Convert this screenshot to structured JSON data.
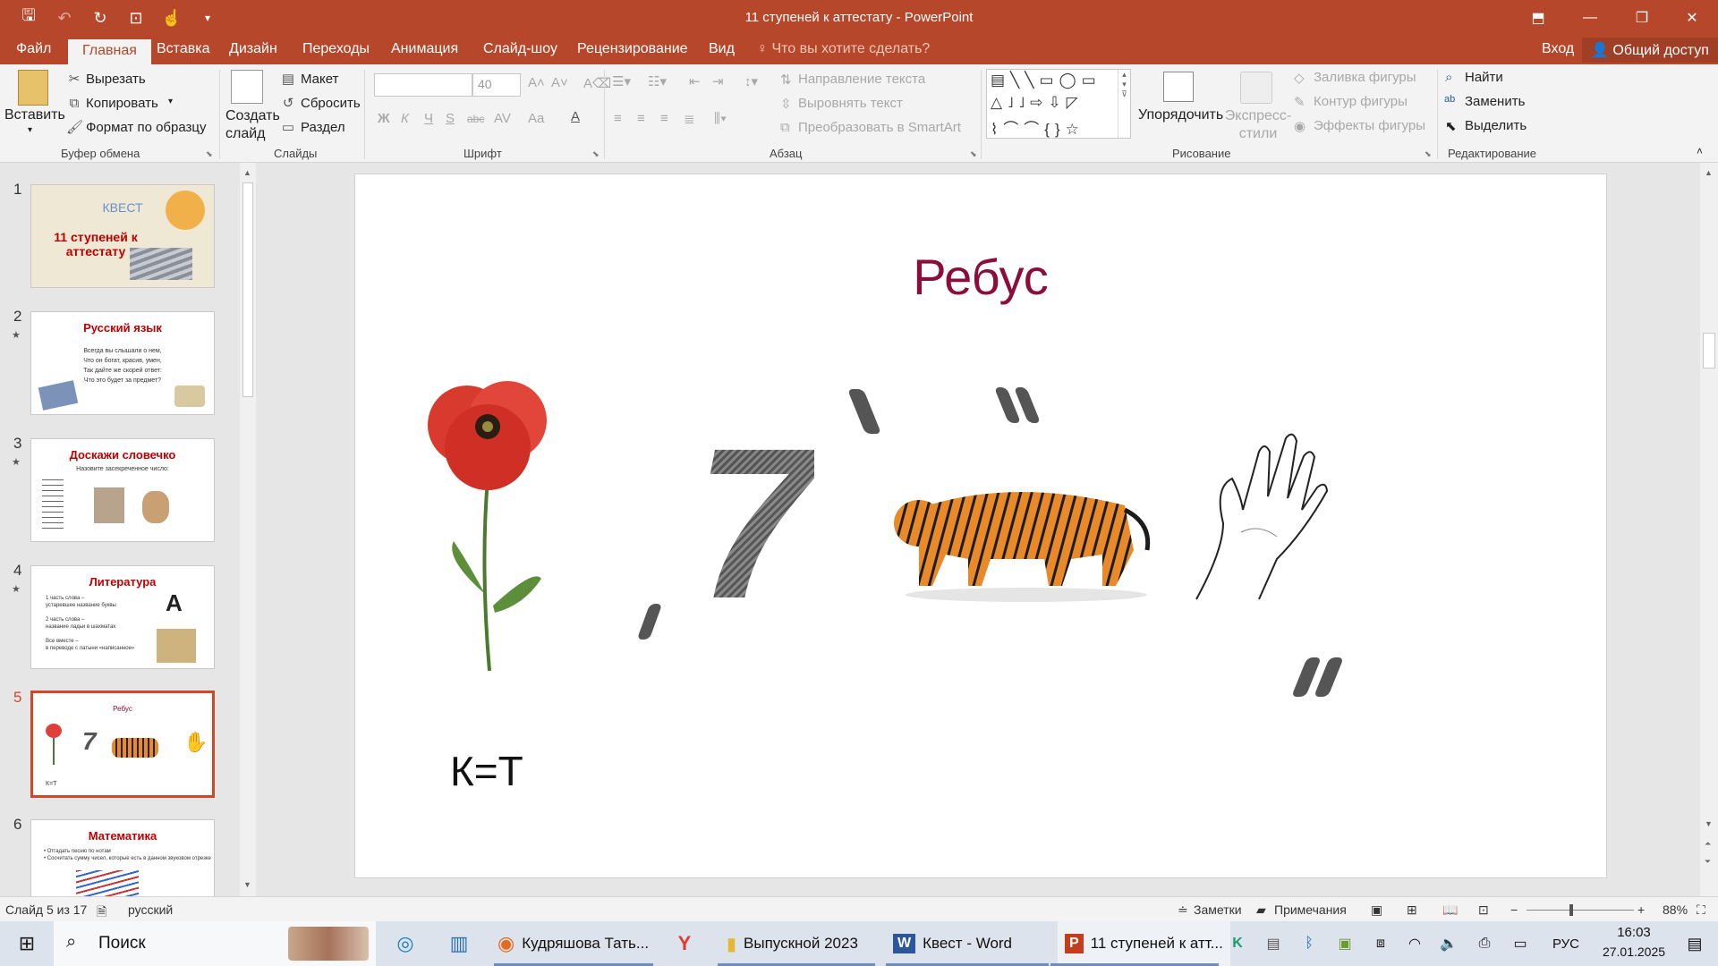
{
  "window": {
    "title": "11 ступеней к аттестату - PowerPoint",
    "qat": [
      "save-icon",
      "undo-icon",
      "redo-icon",
      "present-icon",
      "touch-icon",
      "customize-icon"
    ]
  },
  "tabs": {
    "items": [
      "Файл",
      "Главная",
      "Вставка",
      "Дизайн",
      "Переходы",
      "Анимация",
      "Слайд-шоу",
      "Рецензирование",
      "Вид"
    ],
    "active": "Главная",
    "tell_me": "Что вы хотите сделать?",
    "sign_in": "Вход",
    "share": "Общий доступ"
  },
  "ribbon": {
    "clipboard": {
      "label": "Буфер обмена",
      "paste": "Вставить",
      "cut": "Вырезать",
      "copy": "Копировать",
      "format_painter": "Формат по образцу"
    },
    "slides": {
      "label": "Слайды",
      "new_slide": "Создать слайд",
      "layout": "Макет",
      "reset": "Сбросить",
      "section": "Раздел"
    },
    "font": {
      "label": "Шрифт",
      "size": "40",
      "bold": "Ж",
      "italic": "К",
      "underline": "Ч",
      "strike": "abc",
      "spacing": "AV",
      "case": "Aa"
    },
    "paragraph": {
      "label": "Абзац",
      "text_direction": "Направление текста",
      "align_text": "Выровнять текст",
      "smartart": "Преобразовать в SmartArt"
    },
    "drawing": {
      "label": "Рисование",
      "arrange": "Упорядочить",
      "quick_styles": "Экспресс-стили",
      "fill": "Заливка фигуры",
      "outline": "Контур фигуры",
      "effects": "Эффекты фигуры"
    },
    "editing": {
      "label": "Редактирование",
      "find": "Найти",
      "replace": "Заменить",
      "select": "Выделить"
    }
  },
  "thumbnails": [
    {
      "num": "1",
      "star": false,
      "title": "11 ступеней к аттестату",
      "subtitle": "КВЕСТ"
    },
    {
      "num": "2",
      "star": true,
      "title": "Русский язык",
      "lines": [
        "Всегда вы слышали о нем,",
        "Что он богат, красив, умен,",
        "Так дайте же скорей ответ:",
        "Что это будет за предмет?"
      ]
    },
    {
      "num": "3",
      "star": true,
      "title": "Доскажи словечко",
      "lines": [
        "Назовите засекреченное число:"
      ]
    },
    {
      "num": "4",
      "star": true,
      "title": "Литература",
      "lines": [
        "1 часть слова –",
        "устаревшее название буквы",
        "2 часть слова –",
        "название ладьи в шахматах",
        "Все вместе –",
        "в переводе с латыни «написанное»"
      ]
    },
    {
      "num": "5",
      "star": false,
      "title": "Ребус",
      "note": "К=Т"
    },
    {
      "num": "6",
      "star": false,
      "title": "Математика",
      "lines": [
        "• Отгадать песню по нотам",
        "• Сосчитать сумму чисел, которые есть в данном звуковом отрезке"
      ]
    }
  ],
  "slide": {
    "title": "Ребус",
    "big_digit": "7",
    "note": "К=Т"
  },
  "status": {
    "slide_counter": "Слайд 5 из 17",
    "language": "русский",
    "notes": "Заметки",
    "comments": "Примечания",
    "zoom": "88%"
  },
  "taskbar": {
    "search": "Поиск",
    "apps": [
      {
        "label": "Кудряшова Тать..."
      },
      {
        "label": "Выпускной 2023"
      },
      {
        "label": "Квест - Word"
      },
      {
        "label": "11 ступеней к атт..."
      }
    ],
    "lang": "РУС",
    "time": "16:03",
    "date": "27.01.2025"
  }
}
